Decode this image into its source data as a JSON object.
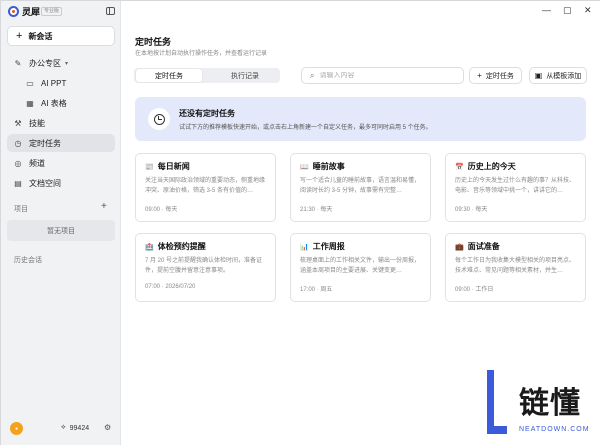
{
  "app": {
    "name": "灵犀",
    "edition": "专业版"
  },
  "sidebar": {
    "new_chat": "新会话",
    "items": [
      {
        "label": "办公专区",
        "icon": "pen-icon"
      },
      {
        "label": "AI PPT",
        "icon": "ppt-icon"
      },
      {
        "label": "AI 表格",
        "icon": "table-icon"
      },
      {
        "label": "技能",
        "icon": "skill-icon"
      },
      {
        "label": "定时任务",
        "icon": "clock-icon"
      },
      {
        "label": "频道",
        "icon": "channel-icon"
      },
      {
        "label": "文档空间",
        "icon": "document-icon"
      }
    ],
    "projects_label": "项目",
    "projects_empty": "暂无项目",
    "history_label": "历史会话",
    "points": "99424"
  },
  "main": {
    "title": "定时任务",
    "subtitle": "在本地按计划自动执行操作任务，并查看运行记录",
    "tabs": [
      "定时任务",
      "执行记录"
    ],
    "search_placeholder": "请输入内容",
    "add_button": "定时任务",
    "template_button": "从模板添加",
    "banner": {
      "title": "还没有定时任务",
      "desc": "试试下方的推荐模板快速开始，或点击右上角新建一个自定义任务，最多可同时启用 5 个任务。"
    },
    "cards": [
      {
        "title": "每日新闻",
        "desc": "关注当天国际政治领域的重要动态，侧重地缘冲突、原油价格，筛选 3-5 条有价值的…",
        "meta": "09:00 · 每天"
      },
      {
        "title": "睡前故事",
        "desc": "写一个适合儿童的睡前故事，语言温和易懂，阅读时长约 3-5 分钟，故事需有完整…",
        "meta": "21:30 · 每天"
      },
      {
        "title": "历史上的今天",
        "desc": "历史上的今天发生过什么有趣的事？从科技、电影、音乐等领域中挑一个，讲讲它的…",
        "meta": "09:30 · 每天"
      },
      {
        "title": "体检预约提醒",
        "desc": "7 月 20 号之前提醒我确认体检时间，准备证件，提前空腹并留意注意事项。",
        "meta": "07:00 · 2026/07/20"
      },
      {
        "title": "工作周报",
        "desc": "梳理桌面上的工作相关文件，输出一份周报，涵盖本周项目的主要进展、关键变更…",
        "meta": "17:00 · 周五"
      },
      {
        "title": "面试准备",
        "desc": "每个工作日为我收集大模型相关的项目亮点、技术难点、常见问题等相关素材，并生…",
        "meta": "09:00 · 工作日"
      }
    ]
  },
  "watermark": {
    "text": "链懂",
    "sub": "NEATDOWN.COM"
  }
}
